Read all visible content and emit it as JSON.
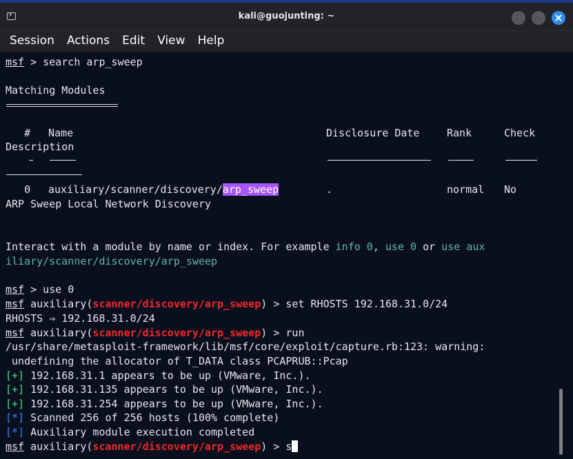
{
  "window": {
    "title": "kali@guojunting: ~"
  },
  "menu": [
    "Session",
    "Actions",
    "Edit",
    "View",
    "Help"
  ],
  "terminal": {
    "prompt": "msf",
    "cmd_search": " > search arp_sweep",
    "matching_modules": "Matching Modules",
    "header_hash": "   #",
    "header_name": "Name",
    "header_date": "Disclosure Date",
    "header_rank": "Rank",
    "header_check": "Check",
    "header_description": "Description",
    "row_index": "   0",
    "row_path_prefix": "auxiliary/scanner/discovery/",
    "row_module": "arp_sweep",
    "row_date": ".",
    "row_rank": "normal",
    "row_check": "No",
    "row_description": "ARP Sweep Local Network Discovery",
    "interact_prefix": "Interact with a module by name or index. For example ",
    "interact_info": "info 0",
    "interact_comma": ", ",
    "interact_use0": "use 0",
    "interact_or": " or ",
    "interact_use_aux1": "use aux",
    "interact_use_aux2": "iliary/scanner/discovery/arp_sweep",
    "cmd_use": " > use 0",
    "aux_prefix": " auxiliary(",
    "aux_module": "scanner/discovery/arp_sweep",
    "aux_suffix": ")",
    "cmd_set": " > set RHOSTS 192.168.31.0/24",
    "rhosts_echo": "RHOSTS ⇒ 192.168.31.0/24",
    "cmd_run": " > run",
    "warning_line1": "/usr/share/metasploit-framework/lib/msf/core/exploit/capture.rb:123: warning:",
    "warning_line2": " undefining the allocator of T_DATA class PCAPRUB::Pcap",
    "plus_tag": "[+]",
    "star_tag": "[*]",
    "host1": " 192.168.31.1 appears to be up (VMware, Inc.).",
    "host2": " 192.168.31.135 appears to be up (VMware, Inc.).",
    "host3": " 192.168.31.254 appears to be up (VMware, Inc.).",
    "scanned": " Scanned 256 of 256 hosts (100% complete)",
    "completed": " Auxiliary module execution completed",
    "cmd_current": " > s"
  },
  "colors": {
    "background": "#0a0f1e",
    "module_red": "#ef2929",
    "success_green": "#4ade80",
    "info_blue": "#3b82f6",
    "hint_teal": "#5fb8a3",
    "highlight_purple": "#a855f7",
    "close_button": "#2f8df0"
  }
}
